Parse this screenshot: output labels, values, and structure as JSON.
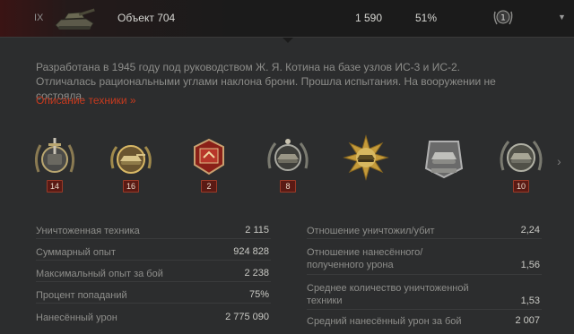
{
  "header": {
    "tier": "IX",
    "tank_name": "Объект 704",
    "battles": "1 590",
    "win_rate": "51%",
    "mastery_level": "1"
  },
  "description": {
    "text": "Разработана в 1945 году под руководством Ж. Я. Котина на базе узлов ИС-3 и ИС-2. Отличалась рациональными углами наклона брони. Прошла испытания. На вооружении не состояла.",
    "link": "Описание техники »"
  },
  "medals": [
    {
      "icon": "sword-medal-icon",
      "count": "14"
    },
    {
      "icon": "tank-gold-medal-icon",
      "count": "16"
    },
    {
      "icon": "red-star-medal-icon",
      "count": "2"
    },
    {
      "icon": "laurel-tank-medal-icon",
      "count": "8"
    },
    {
      "icon": "sunburst-tank-medal-icon",
      "count": ""
    },
    {
      "icon": "silver-tank-medal-icon",
      "count": ""
    },
    {
      "icon": "wreath-tank-medal-icon",
      "count": "10"
    }
  ],
  "stats_left": [
    {
      "label": "Уничтоженная техника",
      "value": "2 115"
    },
    {
      "label": "Суммарный опыт",
      "value": "924 828"
    },
    {
      "label": "Максимальный опыт за бой",
      "value": "2 238"
    },
    {
      "label": "Процент попаданий",
      "value": "75%"
    },
    {
      "label": "Нанесённый урон",
      "value": "2 775 090"
    }
  ],
  "stats_right": [
    {
      "label": "Отношение уничтожил/убит",
      "value": "2,24"
    },
    {
      "label": "Отношение нанесённого/полученного урона",
      "value": "1,56"
    },
    {
      "label": "Среднее количество уничтоженной техники",
      "value": "1,53"
    },
    {
      "label": "Средний нанесённый урон за бой",
      "value": "2 007"
    }
  ],
  "colors": {
    "accent_link": "#c73a1e",
    "background": "#2c2d2e",
    "header": "#1b1b1b"
  }
}
